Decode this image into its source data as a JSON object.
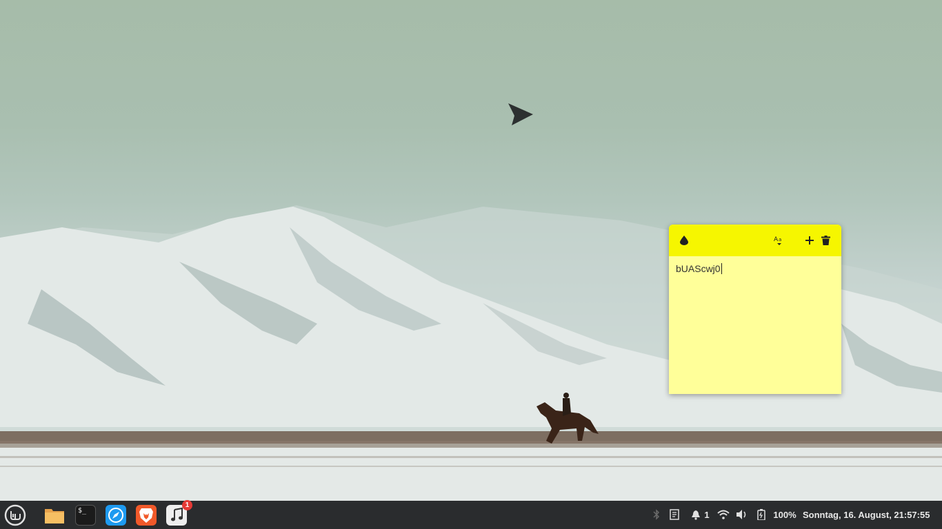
{
  "desktop": {
    "wallpaper": "snowy-mountains-horse-rider-bomber"
  },
  "sticky_note": {
    "text": "bUAScwj0",
    "toolbar_color": "#f6f600",
    "body_color": "#ffff99",
    "icons": [
      "drop-icon",
      "font-size-icon",
      "plus-icon",
      "trash-icon"
    ]
  },
  "taskbar": {
    "menu_icon": "linux-mint-logo-icon",
    "apps": [
      {
        "name": "files",
        "icon": "folder-icon"
      },
      {
        "name": "terminal",
        "icon": "terminal-icon",
        "glyph": "$_"
      },
      {
        "name": "web-browser",
        "icon": "compass-icon"
      },
      {
        "name": "brave",
        "icon": "brave-lion-icon"
      },
      {
        "name": "music",
        "icon": "music-note-icon",
        "badge": "1"
      }
    ],
    "tray": {
      "notification_count": "1",
      "battery": "100%",
      "datetime": "Sonntag, 16. August, 21:57:55"
    }
  }
}
